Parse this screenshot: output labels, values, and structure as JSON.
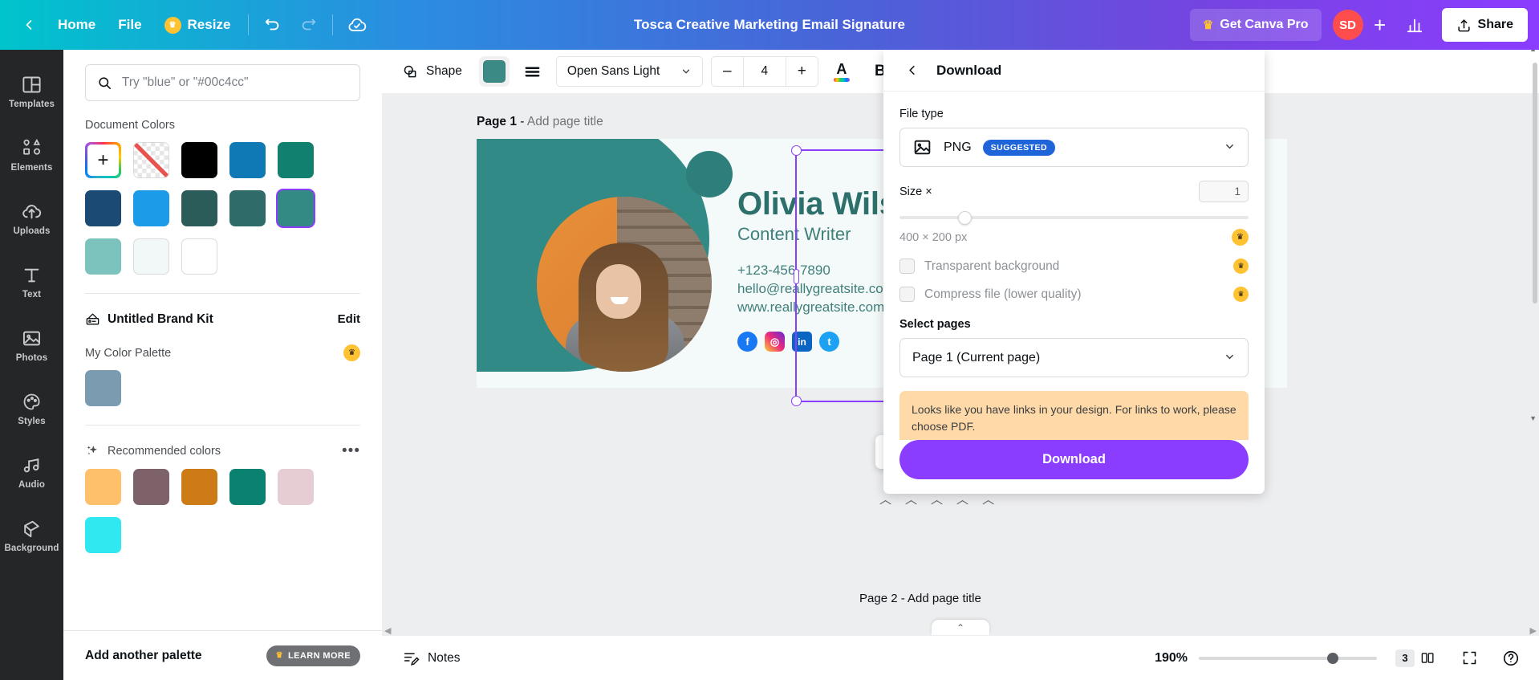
{
  "topbar": {
    "back_icon": "chevron-left-icon",
    "home": "Home",
    "file": "File",
    "resize": "Resize",
    "resize_crown": "♛",
    "undo_icon": "undo-icon",
    "redo_icon": "redo-icon",
    "cloud_icon": "cloud-saved-icon",
    "doc_title": "Tosca Creative Marketing Email Signature",
    "pro_label": "Get Canva Pro",
    "pro_crown": "♛",
    "avatar_initials": "SD",
    "plus": "+",
    "insights_icon": "insights-icon",
    "share": "Share",
    "share_icon": "share-upload-icon"
  },
  "rail": {
    "items": [
      {
        "label": "Templates",
        "icon": "templates-icon"
      },
      {
        "label": "Elements",
        "icon": "elements-icon"
      },
      {
        "label": "Uploads",
        "icon": "uploads-icon"
      },
      {
        "label": "Text",
        "icon": "text-icon"
      },
      {
        "label": "Photos",
        "icon": "photos-icon"
      },
      {
        "label": "Styles",
        "icon": "styles-icon"
      },
      {
        "label": "Audio",
        "icon": "audio-icon"
      },
      {
        "label": "Background",
        "icon": "background-icon"
      }
    ]
  },
  "color_panel": {
    "search_placeholder": "Try \"blue\" or \"#00c4cc\"",
    "search_value": "",
    "search_icon": "search-icon",
    "document_colors_title": "Document Colors",
    "document_colors": [
      {
        "name": "add-color",
        "type": "add",
        "hex": ""
      },
      {
        "name": "no-color",
        "type": "none",
        "hex": ""
      },
      {
        "name": "black",
        "type": "solid",
        "hex": "#000000"
      },
      {
        "name": "blue",
        "type": "solid",
        "hex": "#0f79b5"
      },
      {
        "name": "teal-green",
        "type": "solid",
        "hex": "#12806f"
      },
      {
        "name": "navy",
        "type": "solid",
        "hex": "#1b4a74"
      },
      {
        "name": "sky-blue",
        "type": "solid",
        "hex": "#1c9ce8"
      },
      {
        "name": "dark-teal",
        "type": "solid",
        "hex": "#2c5c5a"
      },
      {
        "name": "slate-teal",
        "type": "solid",
        "hex": "#2f6b68"
      },
      {
        "name": "selected-teal",
        "type": "solid",
        "hex": "#338a84",
        "selected": true
      },
      {
        "name": "light-teal",
        "type": "solid",
        "hex": "#7cc2bd"
      },
      {
        "name": "off-white",
        "type": "solid",
        "hex": "#f2f8f7"
      },
      {
        "name": "white",
        "type": "solid",
        "hex": "#ffffff"
      }
    ],
    "brand_kit_name": "Untitled Brand Kit",
    "brand_kit_icon": "brand-kit-icon",
    "edit_label": "Edit",
    "palette_name": "My Color Palette",
    "palette_crown": "♛",
    "palette_colors": [
      {
        "name": "steel-blue",
        "hex": "#7b9cb0"
      }
    ],
    "recommended_title": "Recommended colors",
    "recommended_icon": "sparkle-icon",
    "recommended_more": "•••",
    "recommended_colors": [
      {
        "name": "light-orange",
        "hex": "#ffc06b"
      },
      {
        "name": "mauve",
        "hex": "#7d6269"
      },
      {
        "name": "burnt-orange",
        "hex": "#cd7b17"
      },
      {
        "name": "teal",
        "hex": "#0a8272"
      },
      {
        "name": "pink-blush",
        "hex": "#e6cdd4"
      },
      {
        "name": "cyan",
        "hex": "#2fe8f0"
      }
    ],
    "add_palette_label": "Add another palette",
    "learn_more_label": "LEARN MORE",
    "learn_more_crown": "♛"
  },
  "toolbar": {
    "shape_label": "Shape",
    "shape_icon": "shape-icon",
    "fill_color": "#3c8a85",
    "align_icon": "align-icon",
    "font_family": "Open Sans Light",
    "font_size": "4",
    "minus": "–",
    "plus": "+",
    "text_color_icon": "text-color-icon",
    "bold_label": "B"
  },
  "canvas": {
    "page_number": "Page 1",
    "page_dash": "-",
    "page_title_placeholder": "Add page title",
    "page2_label": "Page 2 - Add page title",
    "rotate_icon": "rotate-icon",
    "float_toolbar": {
      "duplicate_icon": "duplicate-icon",
      "delete_icon": "trash-icon",
      "more_icon": "more-horizontal-icon"
    },
    "design": {
      "name": "Olivia Wilson",
      "role": "Content Writer",
      "phone": "+123-456-7890",
      "email": "hello@reallygreatsite.com",
      "website": "www.reallygreatsite.com",
      "socials": [
        "facebook-icon",
        "instagram-icon",
        "linkedin-icon",
        "twitter-icon"
      ],
      "accent_teal": "#2c6f6b",
      "accent_orange": "#e8903a"
    }
  },
  "bottombar": {
    "notes_label": "Notes",
    "notes_icon": "notes-icon",
    "zoom_level": "190%",
    "page_count": "3",
    "grid_icon": "grid-pages-icon",
    "fullscreen_icon": "fullscreen-icon",
    "help_icon": "help-icon"
  },
  "download": {
    "title": "Download",
    "back_icon": "chevron-left-icon",
    "file_type_label": "File type",
    "file_type_value": "PNG",
    "file_type_icon": "image-file-icon",
    "suggested_badge": "SUGGESTED",
    "size_label": "Size ×",
    "size_value": "1",
    "dimensions": "400 × 200 px",
    "dimensions_crown": "♛",
    "transparent_label": "Transparent background",
    "transparent_crown": "♛",
    "transparent_checked": false,
    "compress_label": "Compress file (lower quality)",
    "compress_crown": "♛",
    "compress_checked": false,
    "select_pages_label": "Select pages",
    "select_pages_value": "Page 1 (Current page)",
    "warning": "Looks like you have links in your design. For links to work, please choose PDF.",
    "download_button": "Download"
  }
}
